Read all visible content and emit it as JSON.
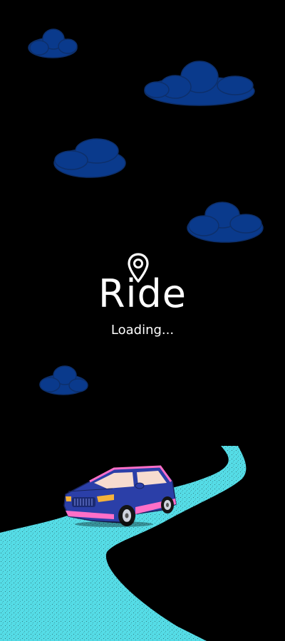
{
  "app": {
    "brand_name": "Ride",
    "loading_text": "Loading..."
  },
  "colors": {
    "background": "#000000",
    "cloud": "#0a3a8c",
    "cloud_outline": "#0d2f6b",
    "road": "#55dce6",
    "road_speckle": "#1a2a2a",
    "car_body": "#2b3fa8",
    "car_trim": "#ff6fc8",
    "car_window": "#f6dccf",
    "brand_text": "#ffffff"
  },
  "icons": {
    "logo_pin": "location-pin-icon"
  }
}
